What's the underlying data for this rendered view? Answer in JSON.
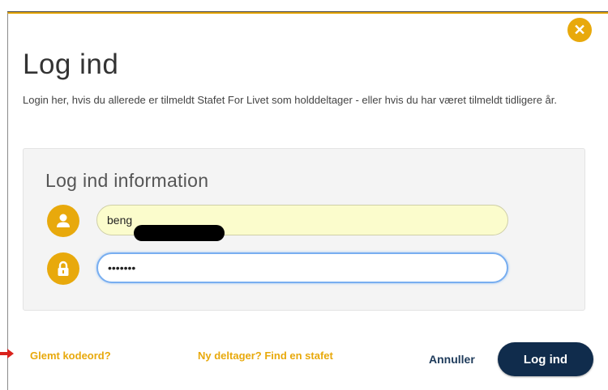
{
  "dialog": {
    "title": "Log ind",
    "intro": "Login her, hvis du allerede er tilmeldt Stafet For Livet som holddeltager - eller hvis du har været tilmeldt tidligere år.",
    "close_icon": "close-icon"
  },
  "form": {
    "section_title": "Log ind information",
    "username": {
      "value": "beng",
      "icon": "user-icon"
    },
    "password": {
      "value": "•••••••",
      "icon": "lock-icon"
    }
  },
  "actions": {
    "forgot_label": "Glemt kodeord?",
    "new_participant_label": "Ny deltager? Find en stafet",
    "cancel_label": "Annuller",
    "login_label": "Log ind"
  },
  "colors": {
    "accent": "#e8a90c",
    "primary_button": "#102c4c",
    "cancel_text": "#1d3a5a",
    "focus_border": "#78aef0",
    "autofill_bg": "#fbfccc"
  }
}
